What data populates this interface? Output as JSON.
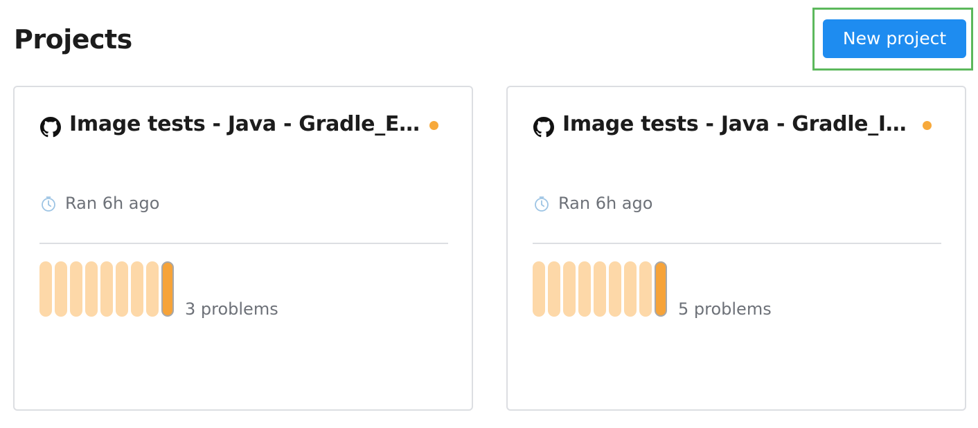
{
  "header": {
    "title": "Projects",
    "new_project_label": "New project"
  },
  "colors": {
    "accent": "#1e8cf0",
    "highlight_border": "#5cb85c",
    "status_warning": "#f7a93b",
    "bar_inactive": "#fdd8a8",
    "bar_active": "#f6a339",
    "bar_active_border": "#a8a8a8"
  },
  "projects": [
    {
      "icon": "github-icon",
      "title": "Image tests - Java - Gradle_Excl...",
      "status": "warning",
      "ran": "Ran 6h ago",
      "run_history": [
        "past",
        "past",
        "past",
        "past",
        "past",
        "past",
        "past",
        "past",
        "latest"
      ],
      "problems": "3 problems"
    },
    {
      "icon": "github-icon",
      "title": "Image tests - Java - Gradle_Incl...",
      "status": "warning",
      "ran": "Ran 6h ago",
      "run_history": [
        "past",
        "past",
        "past",
        "past",
        "past",
        "past",
        "past",
        "past",
        "latest"
      ],
      "problems": "5 problems"
    }
  ]
}
